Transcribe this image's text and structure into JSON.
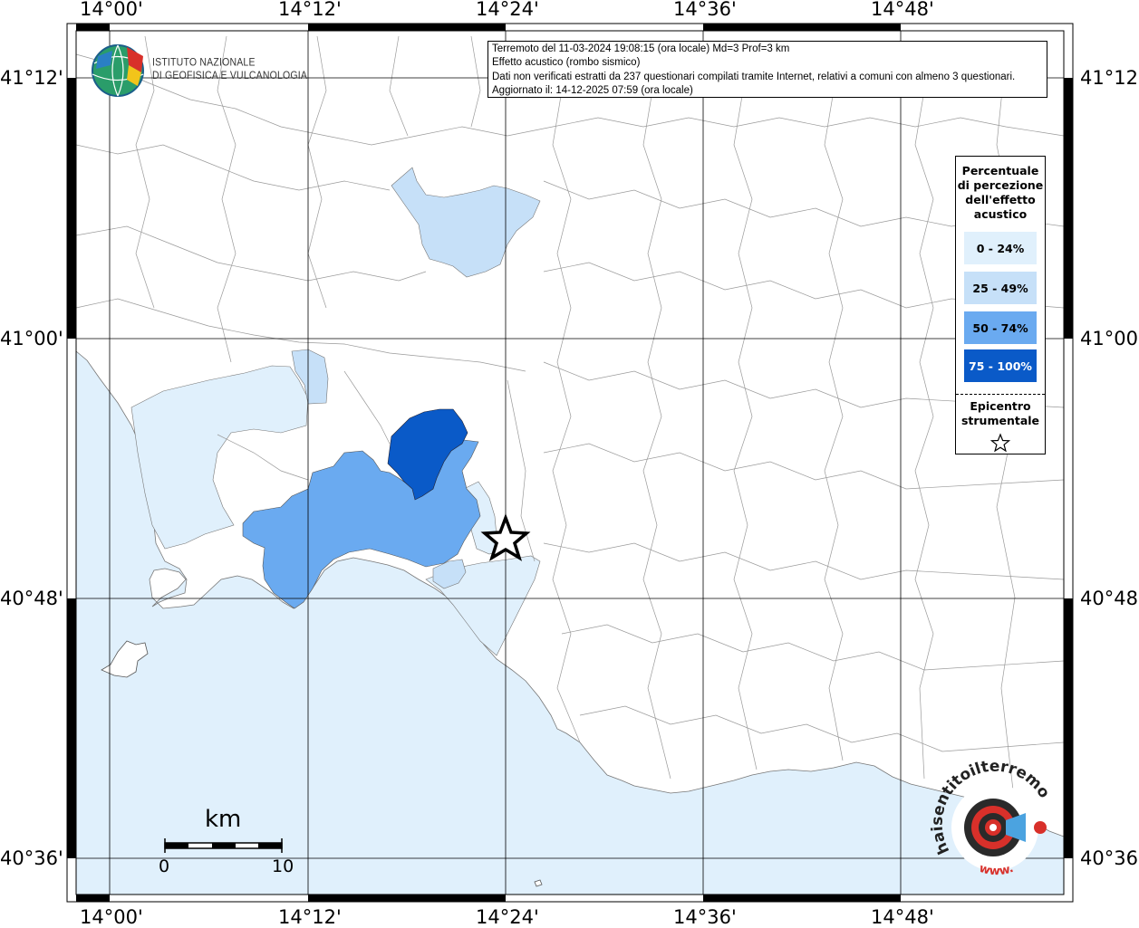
{
  "map": {
    "lon_labels": [
      "14°00'",
      "14°12'",
      "14°24'",
      "14°36'",
      "14°48'"
    ],
    "lat_labels": [
      "41°12'",
      "41°00'",
      "40°48'",
      "40°36'"
    ],
    "colors": {
      "sea": "#e0f0fc",
      "class_0_24": "#e0f0fc",
      "class_25_49": "#c6e0f8",
      "class_50_74": "#6aaaf0",
      "class_75_100": "#0a5ac8",
      "land": "#ffffff",
      "grid": "#000000"
    }
  },
  "logo": {
    "line1": "ISTITUTO NAZIONALE",
    "line2": "DI GEOFISICA E VULCANOLOGIA"
  },
  "info": {
    "line1": "Terremoto del 11-03-2024 19:08:15 (ora locale) Md=3 Prof=3 km",
    "line2": "Effetto acustico (rombo sismico)",
    "line3": "Dati non verificati estratti da 237 questionari compilati tramite Internet, relativi a comuni con almeno 3 questionari.",
    "line4": "Aggiornato il: 14-12-2025 07:59 (ora locale)"
  },
  "legend": {
    "title_lines": [
      "Percentuale",
      "di percezione",
      "dell'effetto",
      "acustico"
    ],
    "items": [
      {
        "label": "0 - 24%",
        "color": "#e0f0fc",
        "text_color": "#000000"
      },
      {
        "label": "25 - 49%",
        "color": "#c6e0f8",
        "text_color": "#000000"
      },
      {
        "label": "50 - 74%",
        "color": "#6aaaf0",
        "text_color": "#000000"
      },
      {
        "label": "75 - 100%",
        "color": "#0a5ac8",
        "text_color": "#ffffff"
      }
    ],
    "epicenter_line1": "Epicentro",
    "epicenter_line2": "strumentale",
    "epicenter_icon": "star-icon"
  },
  "scale": {
    "title": "km",
    "start": "0",
    "end": "10"
  },
  "badge": {
    "text_top": "haisentitoilterremoto.it",
    "text_bottom": "www.",
    "icon": "speaker-target-icon"
  }
}
